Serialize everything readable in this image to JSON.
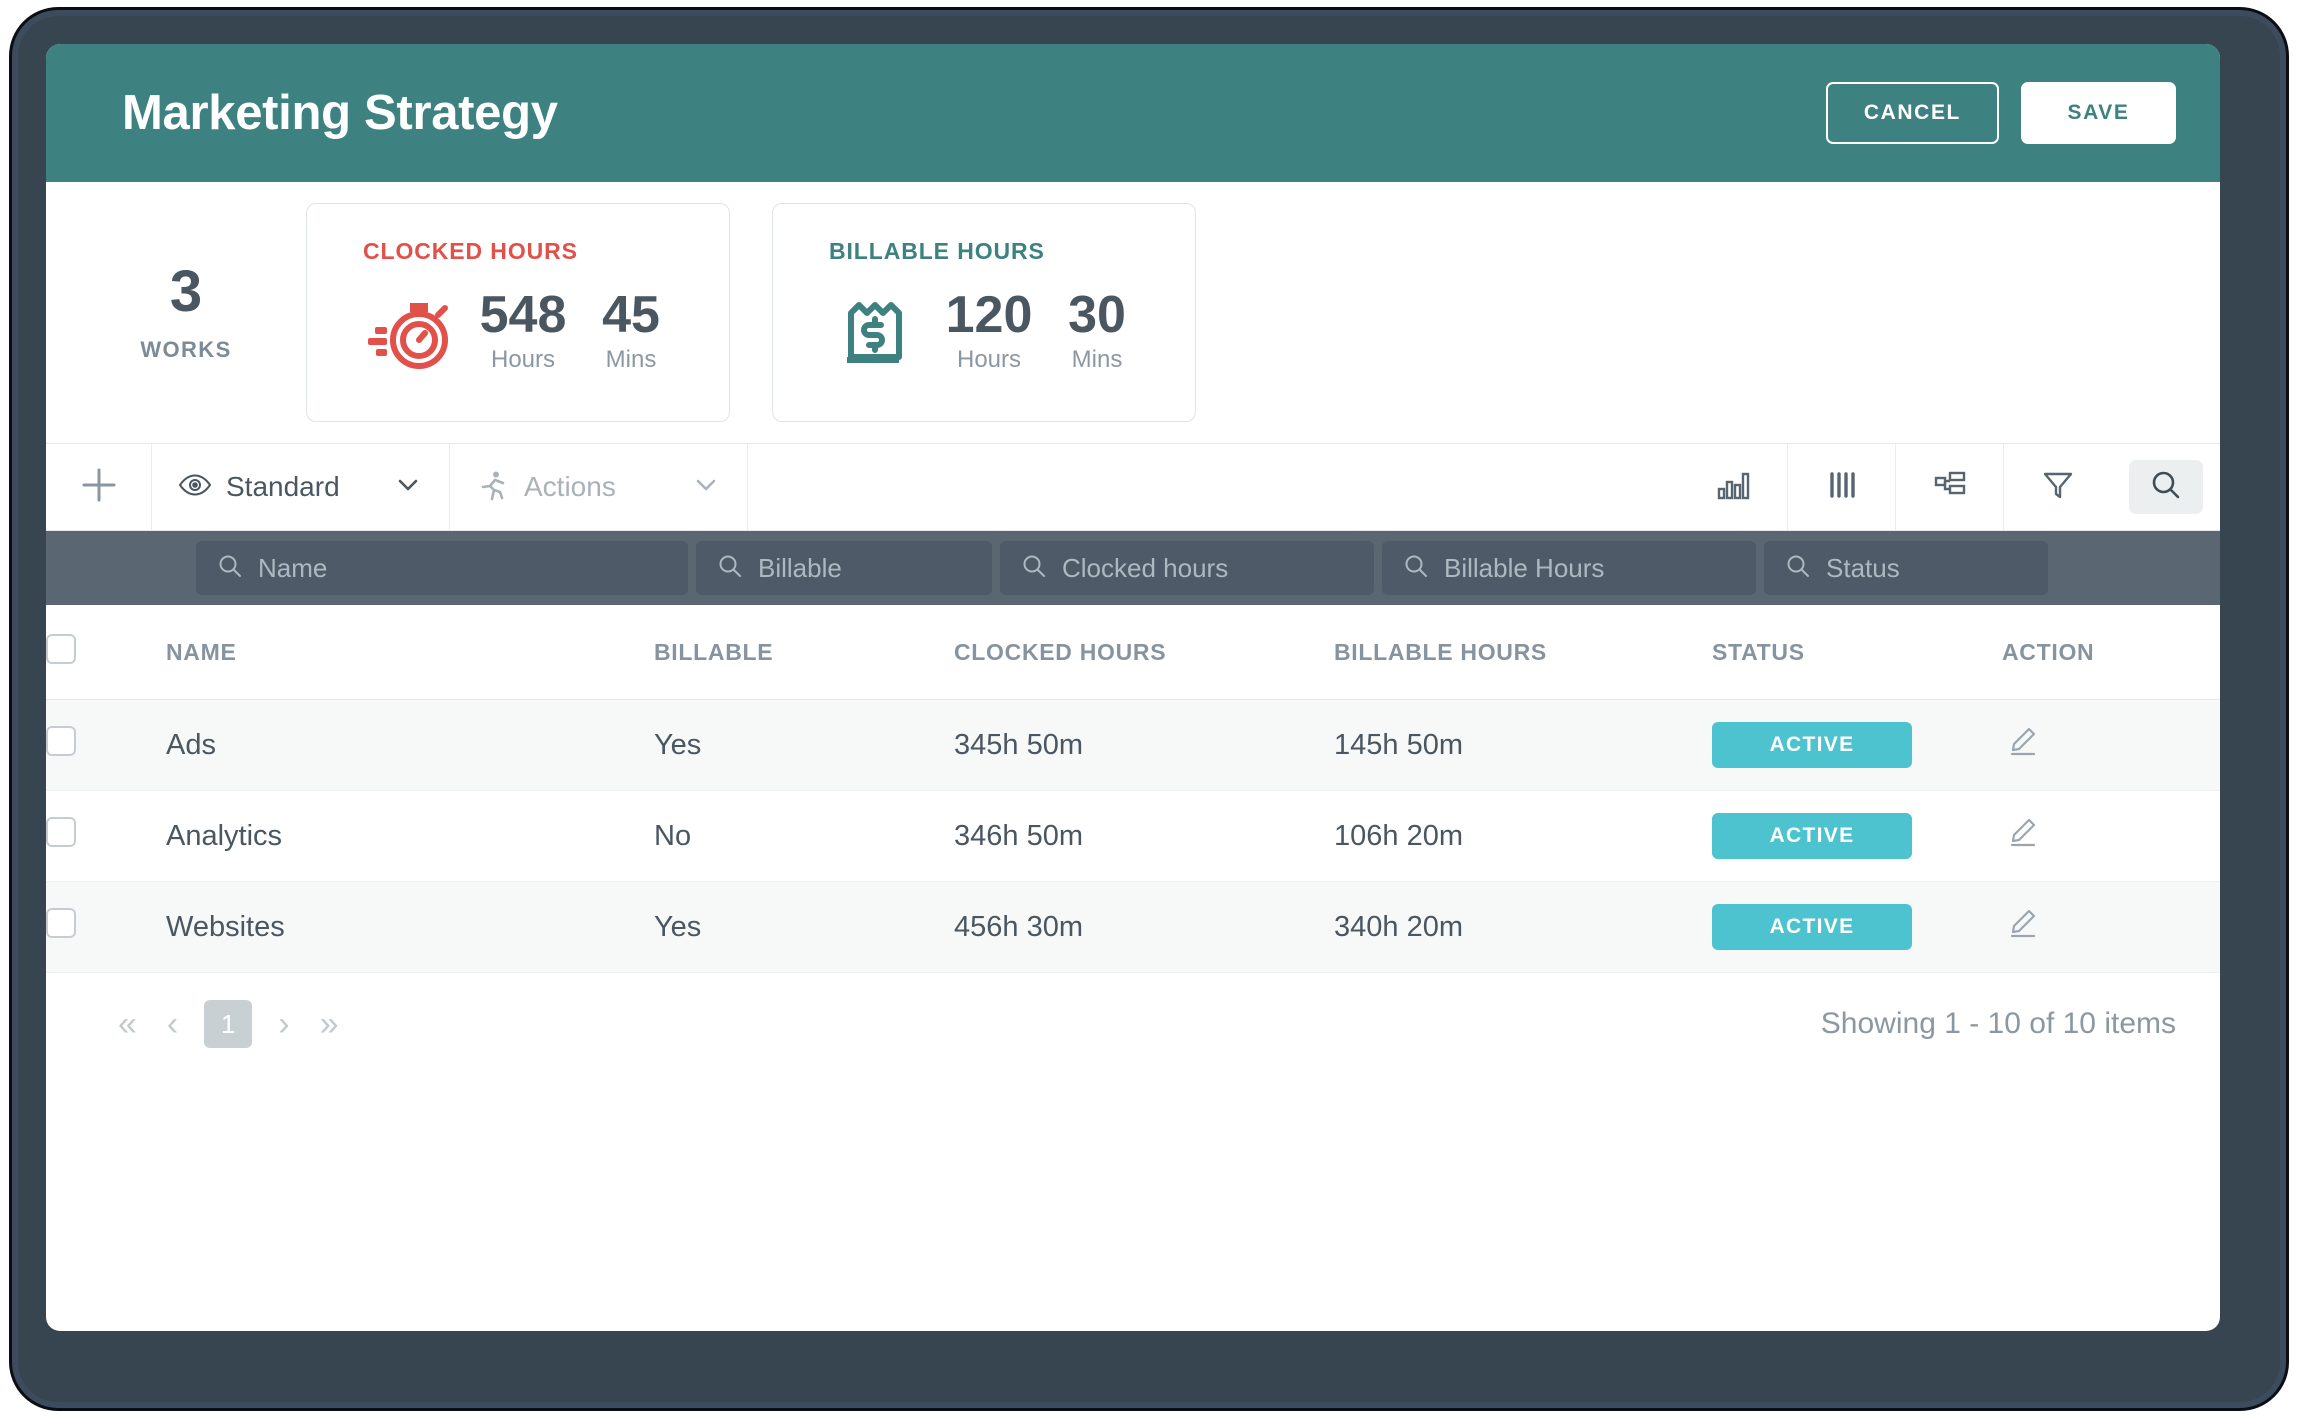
{
  "header": {
    "title": "Marketing Strategy",
    "cancel_label": "CANCEL",
    "save_label": "SAVE",
    "background_color": "#3d8180"
  },
  "stats": {
    "works": {
      "count": "3",
      "label": "WORKS"
    },
    "cards": [
      {
        "title": "CLOCKED HOURS",
        "icon": "stopwatch-icon",
        "accent_color": "#e2504a",
        "hours_value": "548",
        "hours_label": "Hours",
        "mins_value": "45",
        "mins_label": "Mins"
      },
      {
        "title": "BILLABLE HOURS",
        "icon": "receipt-dollar-icon",
        "accent_color": "#3d8180",
        "hours_value": "120",
        "hours_label": "Hours",
        "mins_value": "30",
        "mins_label": "Mins"
      }
    ]
  },
  "toolbar": {
    "add_icon": "plus-icon",
    "view_select": {
      "icon": "eye-icon",
      "label": "Standard",
      "chevron": "chevron-down-icon"
    },
    "actions_select": {
      "icon": "runner-icon",
      "label": "Actions",
      "chevron": "chevron-down-icon"
    },
    "icons": [
      {
        "name": "chart-icon"
      },
      {
        "name": "columns-icon"
      },
      {
        "name": "group-tree-icon"
      },
      {
        "name": "filter-funnel-icon"
      }
    ],
    "search_icon": "search-icon"
  },
  "filters": [
    {
      "key": "name",
      "placeholder": "Name",
      "value": "",
      "icon": "search-icon"
    },
    {
      "key": "billable",
      "placeholder": "Billable",
      "value": "",
      "icon": "search-icon"
    },
    {
      "key": "clocked",
      "placeholder": "Clocked hours",
      "value": "",
      "icon": "search-icon"
    },
    {
      "key": "billable_hours",
      "placeholder": "Billable Hours",
      "value": "",
      "icon": "search-icon"
    },
    {
      "key": "status",
      "placeholder": "Status",
      "value": "",
      "icon": "search-icon"
    }
  ],
  "table": {
    "columns": [
      "NAME",
      "BILLABLE",
      "CLOCKED HOURS",
      "BILLABLE HOURS",
      "STATUS",
      "ACTION"
    ],
    "rows": [
      {
        "name": "Ads",
        "billable": "Yes",
        "clocked_hours": "345h 50m",
        "billable_hours": "145h 50m",
        "status": "ACTIVE",
        "action_icon": "edit-pencil-icon"
      },
      {
        "name": "Analytics",
        "billable": "No",
        "clocked_hours": "346h 50m",
        "billable_hours": "106h 20m",
        "status": "ACTIVE",
        "action_icon": "edit-pencil-icon"
      },
      {
        "name": "Websites",
        "billable": "Yes",
        "clocked_hours": "456h 30m",
        "billable_hours": "340h 20m",
        "status": "ACTIVE",
        "action_icon": "edit-pencil-icon"
      }
    ],
    "status_badge_color": "#4ec3d0"
  },
  "pagination": {
    "first": "«",
    "prev": "‹",
    "current_page": "1",
    "next": "›",
    "last": "»",
    "showing_text": "Showing 1 - 10 of 10 items"
  }
}
